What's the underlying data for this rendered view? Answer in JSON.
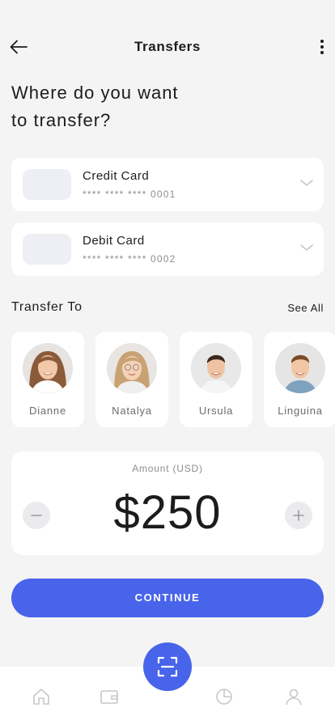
{
  "header": {
    "title": "Transfers",
    "back_icon": "arrow-left-icon",
    "more_icon": "more-vertical-icon"
  },
  "question": {
    "line1": "Where do you want",
    "line2": "to transfer?"
  },
  "cards": [
    {
      "name": "Credit Card",
      "number": "**** **** **** 0001"
    },
    {
      "name": "Debit Card",
      "number": "**** **** **** 0002"
    }
  ],
  "transfer_to": {
    "title": "Transfer To",
    "see_all": "See All",
    "contacts": [
      {
        "name": "Dianne"
      },
      {
        "name": "Natalya"
      },
      {
        "name": "Ursula"
      },
      {
        "name": "Linguina"
      }
    ]
  },
  "amount": {
    "label": "Amount (USD)",
    "value": "$250"
  },
  "continue_label": "CONTINUE",
  "colors": {
    "accent": "#4864ea",
    "background": "#f4f4f4",
    "card": "#ffffff"
  },
  "bottom_nav": {
    "items": [
      "home-icon",
      "wallet-icon",
      "scan-icon",
      "chart-pie-icon",
      "user-icon"
    ]
  }
}
